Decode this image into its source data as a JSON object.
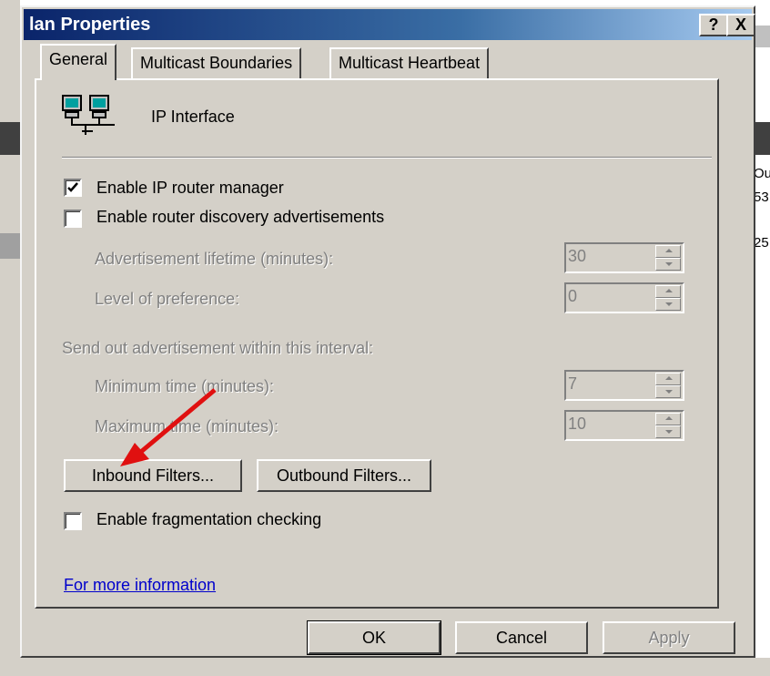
{
  "background": {
    "fragments": [
      "Ou",
      "53",
      "25"
    ]
  },
  "dialog": {
    "title": "lan Properties",
    "help_button": "?",
    "close_button": "X"
  },
  "tabs": [
    {
      "label": "General",
      "active": true
    },
    {
      "label": "Multicast Boundaries",
      "active": false
    },
    {
      "label": "Multicast Heartbeat",
      "active": false
    }
  ],
  "general": {
    "interface_icon": "network-computers-icon",
    "interface_label": "IP Interface",
    "enable_ip_router_manager": {
      "label": "Enable IP router manager",
      "checked": true
    },
    "enable_router_discovery": {
      "label": "Enable router discovery advertisements",
      "checked": false
    },
    "advertisement_lifetime": {
      "label": "Advertisement lifetime (minutes):",
      "value": "30"
    },
    "level_of_preference": {
      "label": "Level of preference:",
      "value": "0"
    },
    "interval_heading": "Send out advertisement within this interval:",
    "minimum_time": {
      "label": "Minimum time (minutes):",
      "value": "7"
    },
    "maximum_time": {
      "label": "Maximum time (minutes):",
      "value": "10"
    },
    "inbound_filters_button": "Inbound Filters...",
    "outbound_filters_button": "Outbound Filters...",
    "enable_fragmentation_checking": {
      "label": "Enable fragmentation checking",
      "checked": false
    },
    "more_info_link": "For more information"
  },
  "footer": {
    "ok_label": "OK",
    "cancel_label": "Cancel",
    "apply_label": "Apply"
  },
  "annotation": {
    "type": "red-arrow",
    "points_to": "inbound-filters-button",
    "color": "#e01010"
  },
  "colors": {
    "dialog_face": "#d4d0c8",
    "titlebar_start": "#0a246a",
    "titlebar_end": "#a6caf0",
    "link": "#0000cc",
    "disabled_text": "#808080"
  }
}
